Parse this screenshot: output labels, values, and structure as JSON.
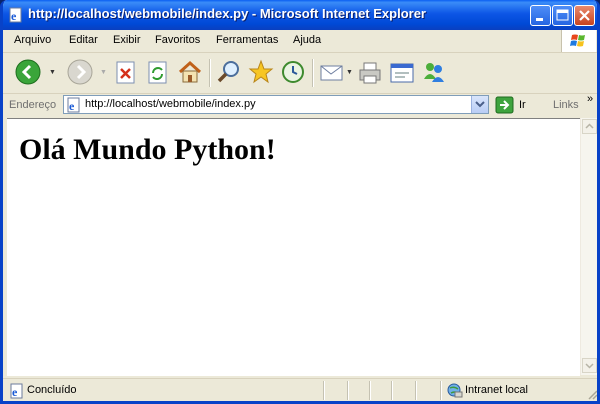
{
  "window": {
    "title": "http://localhost/webmobile/index.py - Microsoft Internet Explorer"
  },
  "menu": [
    {
      "label": "Arquivo"
    },
    {
      "label": "Editar"
    },
    {
      "label": "Exibir"
    },
    {
      "label": "Favoritos"
    },
    {
      "label": "Ferramentas"
    },
    {
      "label": "Ajuda"
    }
  ],
  "toolbar": {
    "icons": [
      "back-icon",
      "forward-icon",
      "stop-icon",
      "refresh-icon",
      "home-icon",
      "search-icon",
      "favorites-star-icon",
      "history-icon",
      "mail-icon",
      "print-icon",
      "edit-icon",
      "messenger-icon"
    ]
  },
  "address": {
    "label": "Endereço",
    "url": "http://localhost/webmobile/index.py",
    "go_label": "Ir",
    "links_label": "Links",
    "chevron": "»"
  },
  "page": {
    "heading": "Olá Mundo Python!"
  },
  "status": {
    "text": "Concluído",
    "zone": "Intranet local"
  },
  "colors": {
    "titlebar": "#0a5ff2",
    "close": "#c8431f",
    "chrome": "#ece9d8"
  }
}
